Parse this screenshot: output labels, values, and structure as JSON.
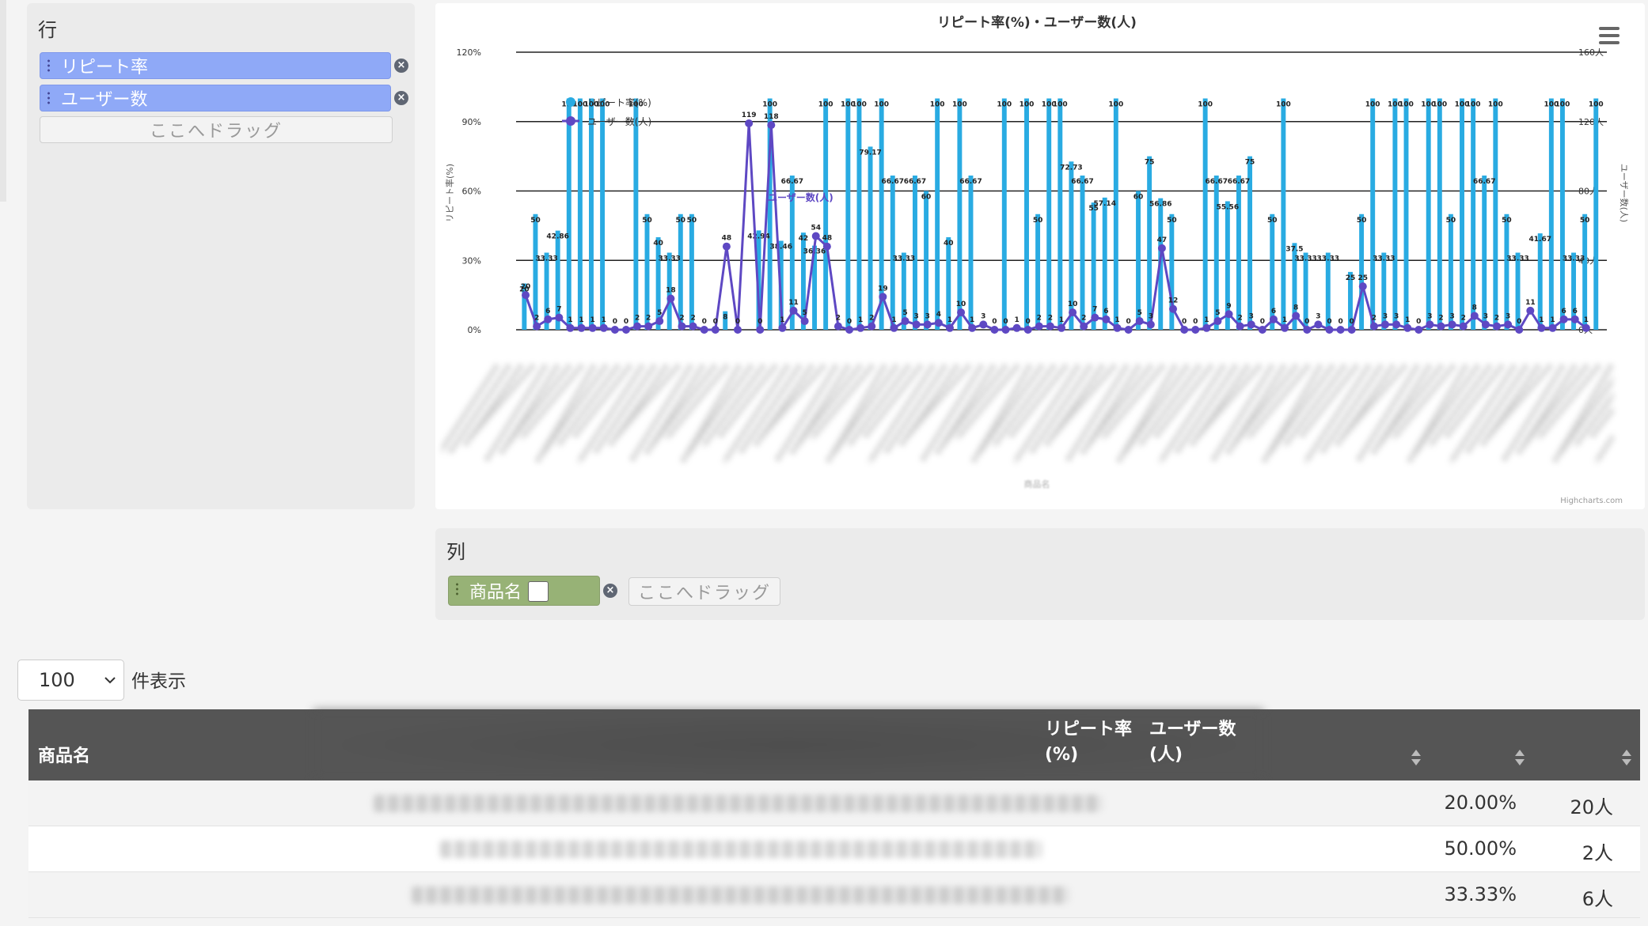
{
  "row_panel": {
    "title": "行",
    "fields": [
      {
        "label": "リピート率",
        "color": "#8fa9f7"
      },
      {
        "label": "ユーザー数",
        "color": "#8fa9f7"
      }
    ],
    "drop_placeholder": "ここへドラッグ"
  },
  "col_panel": {
    "title": "列",
    "fields": [
      {
        "label": "商品名",
        "color": "#97b276"
      }
    ],
    "drop_placeholder": "ここへドラッグ"
  },
  "chart": {
    "credits": "Highcharts.com",
    "menu_icon": "hamburger-menu-icon",
    "colors": {
      "bar": "#29abe2",
      "line": "#5e48c3"
    }
  },
  "chart_data": {
    "type": "bar",
    "title": "リピート率(%)・ユーザー数(人)",
    "xlabel": "商品名",
    "ylabel": "リピート率(%)",
    "y2label": "ユーザー数(人)",
    "ylim": [
      0,
      120
    ],
    "y2lim": [
      0,
      160
    ],
    "yticks": [
      "0%",
      "30%",
      "60%",
      "90%",
      "120%"
    ],
    "y2ticks": [
      "0人",
      "40人",
      "80人",
      "120人",
      "160人"
    ],
    "grid": true,
    "legend_position": "top-left",
    "series": [
      {
        "name": "リピート率(%)",
        "type": "bar",
        "axis": "left",
        "values": [
          20,
          50,
          33.33,
          42.86,
          100,
          100,
          100,
          100,
          0,
          0,
          100,
          50,
          40,
          33.33,
          50,
          50,
          0,
          0,
          8,
          0,
          0,
          42.94,
          100,
          38.46,
          66.67,
          42,
          36.36,
          100,
          0,
          100,
          100,
          79.17,
          100,
          66.67,
          33.33,
          66.67,
          60,
          100,
          40,
          100,
          66.67,
          0,
          0,
          100,
          0,
          100,
          50,
          100,
          100,
          72.73,
          66.67,
          55,
          57.14,
          100,
          0,
          60,
          75,
          56.86,
          50,
          0,
          0,
          100,
          66.67,
          55.56,
          66.67,
          75,
          0,
          50,
          100,
          37.5,
          33.33,
          0,
          33.33,
          0,
          25,
          50,
          100,
          33.33,
          100,
          100,
          0,
          100,
          100,
          50,
          100,
          100,
          66.67,
          100,
          50,
          33.33,
          0,
          41.67,
          100,
          100,
          33.33,
          50,
          100
        ]
      },
      {
        "name": "ユーザー数(人)",
        "type": "line",
        "axis": "right",
        "values": [
          20,
          2,
          6,
          7,
          1,
          1,
          1,
          1,
          0,
          0,
          2,
          2,
          5,
          18,
          2,
          2,
          0,
          0,
          48,
          0,
          119,
          0,
          118,
          1,
          11,
          5,
          54,
          48,
          2,
          0,
          1,
          2,
          19,
          1,
          5,
          3,
          3,
          4,
          1,
          10,
          1,
          3,
          0,
          0,
          1,
          0,
          2,
          2,
          1,
          10,
          2,
          7,
          6,
          1,
          0,
          5,
          3,
          47,
          12,
          0,
          0,
          1,
          5,
          9,
          2,
          3,
          0,
          6,
          1,
          8,
          0,
          3,
          0,
          0,
          0,
          25,
          2,
          3,
          3,
          1,
          0,
          3,
          2,
          3,
          2,
          8,
          3,
          2,
          3,
          0,
          11,
          1,
          1,
          6,
          6,
          1
        ]
      }
    ],
    "annotations": [
      "ユーザー数(人)"
    ]
  },
  "table": {
    "page_size": "100",
    "page_size_label": "件表示",
    "columns": [
      "商品名",
      "リピート率(%)",
      "ユーザー数(人)"
    ],
    "rows": [
      {
        "repeat_rate": "20.00%",
        "users": "20人"
      },
      {
        "repeat_rate": "50.00%",
        "users": "2人"
      },
      {
        "repeat_rate": "33.33%",
        "users": "6人"
      }
    ]
  }
}
